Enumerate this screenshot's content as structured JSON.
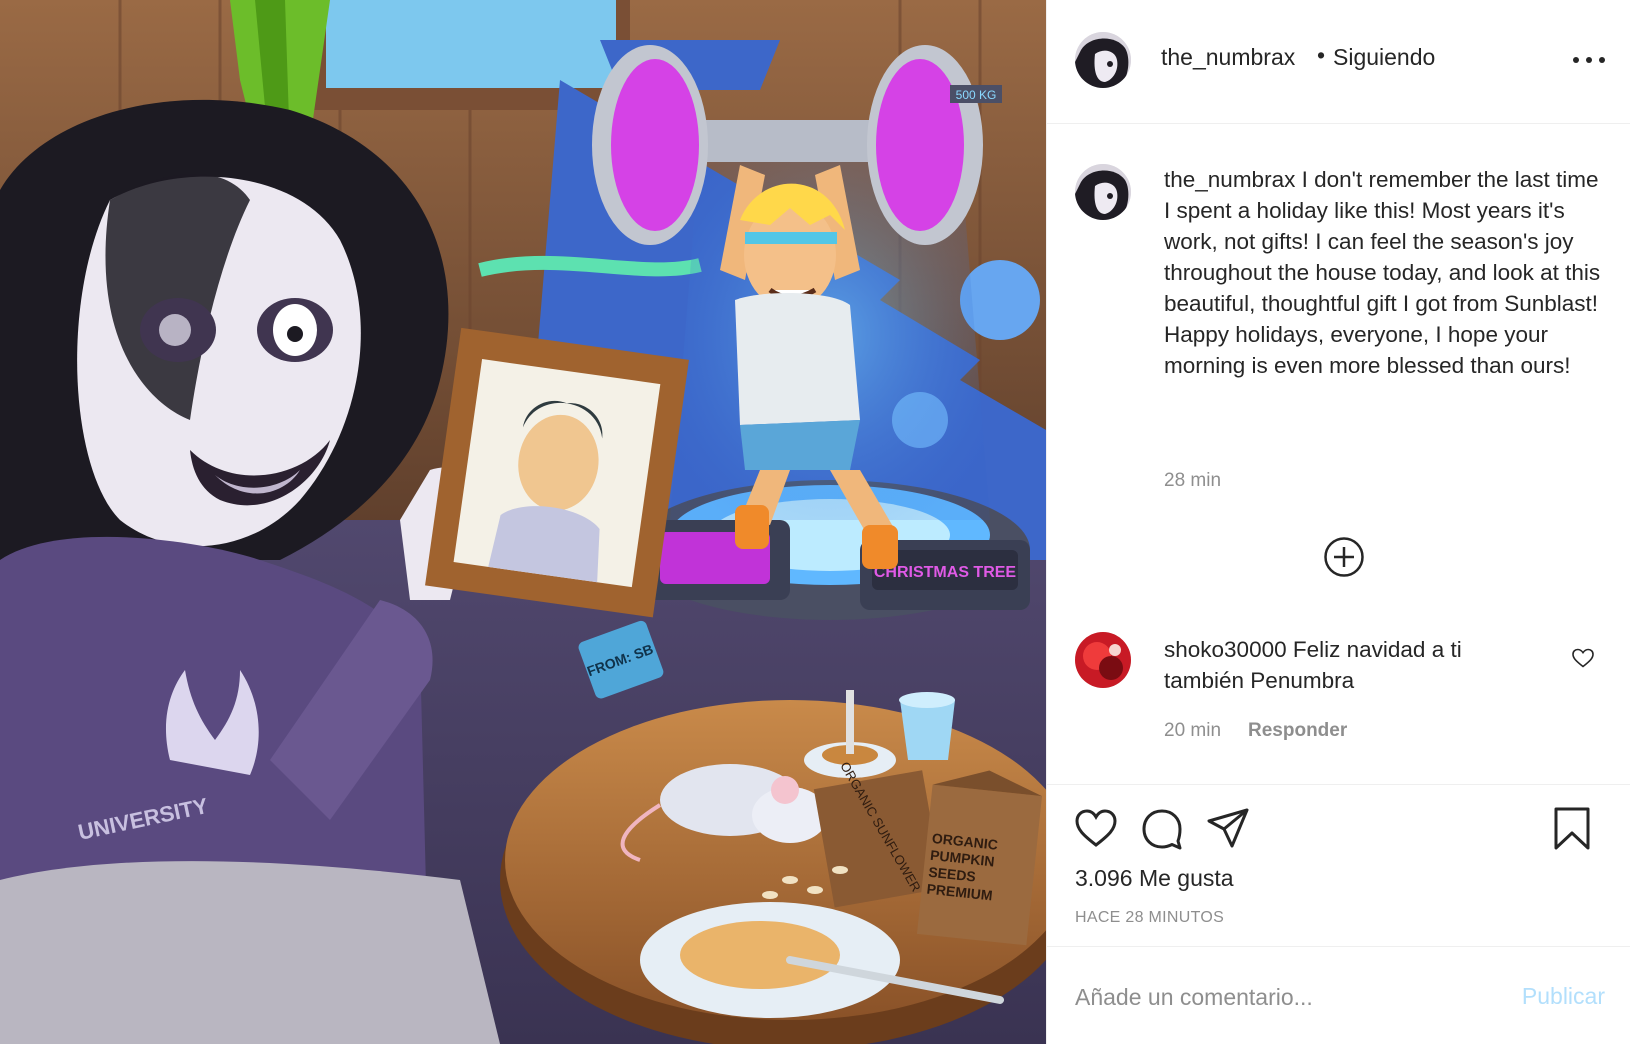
{
  "header": {
    "username": "the_numbrax",
    "separator": "•",
    "follow_status": "Siguiendo"
  },
  "caption": {
    "username": "the_numbrax",
    "text": "I don't remember the last time I spent a holiday like this! Most years it's work, not gifts! I can feel the season's joy throughout the house today, and look at this beautiful, thoughtful gift I got from Sunblast! Happy holidays, everyone, I hope your morning is even more blessed than ours!",
    "time": "28 min"
  },
  "comment": {
    "username": "shoko30000",
    "text": "Feliz navidad a ti también Penumbra",
    "time": "20 min",
    "reply_label": "Responder"
  },
  "stats": {
    "likes": "3.096 Me gusta",
    "date": "HACE 28 MINUTOS"
  },
  "add_comment": {
    "placeholder": "Añade un comentario...",
    "publish_label": "Publicar"
  },
  "illustration": {
    "weight_label": "500 KG",
    "sweater_text": "UNIVERSITY",
    "tag_text": "FROM: SB",
    "machine_text": "CHRISTMAS TREE",
    "bag1_text": "ORGANIC SUNFLOWER",
    "bag2_text": "ORGANIC PUMPKIN SEEDS PREMIUM"
  },
  "colors": {
    "accent_blue_disabled": "#b2dffc",
    "secondary_text": "#8e8e8e",
    "primary_text": "#262626"
  }
}
